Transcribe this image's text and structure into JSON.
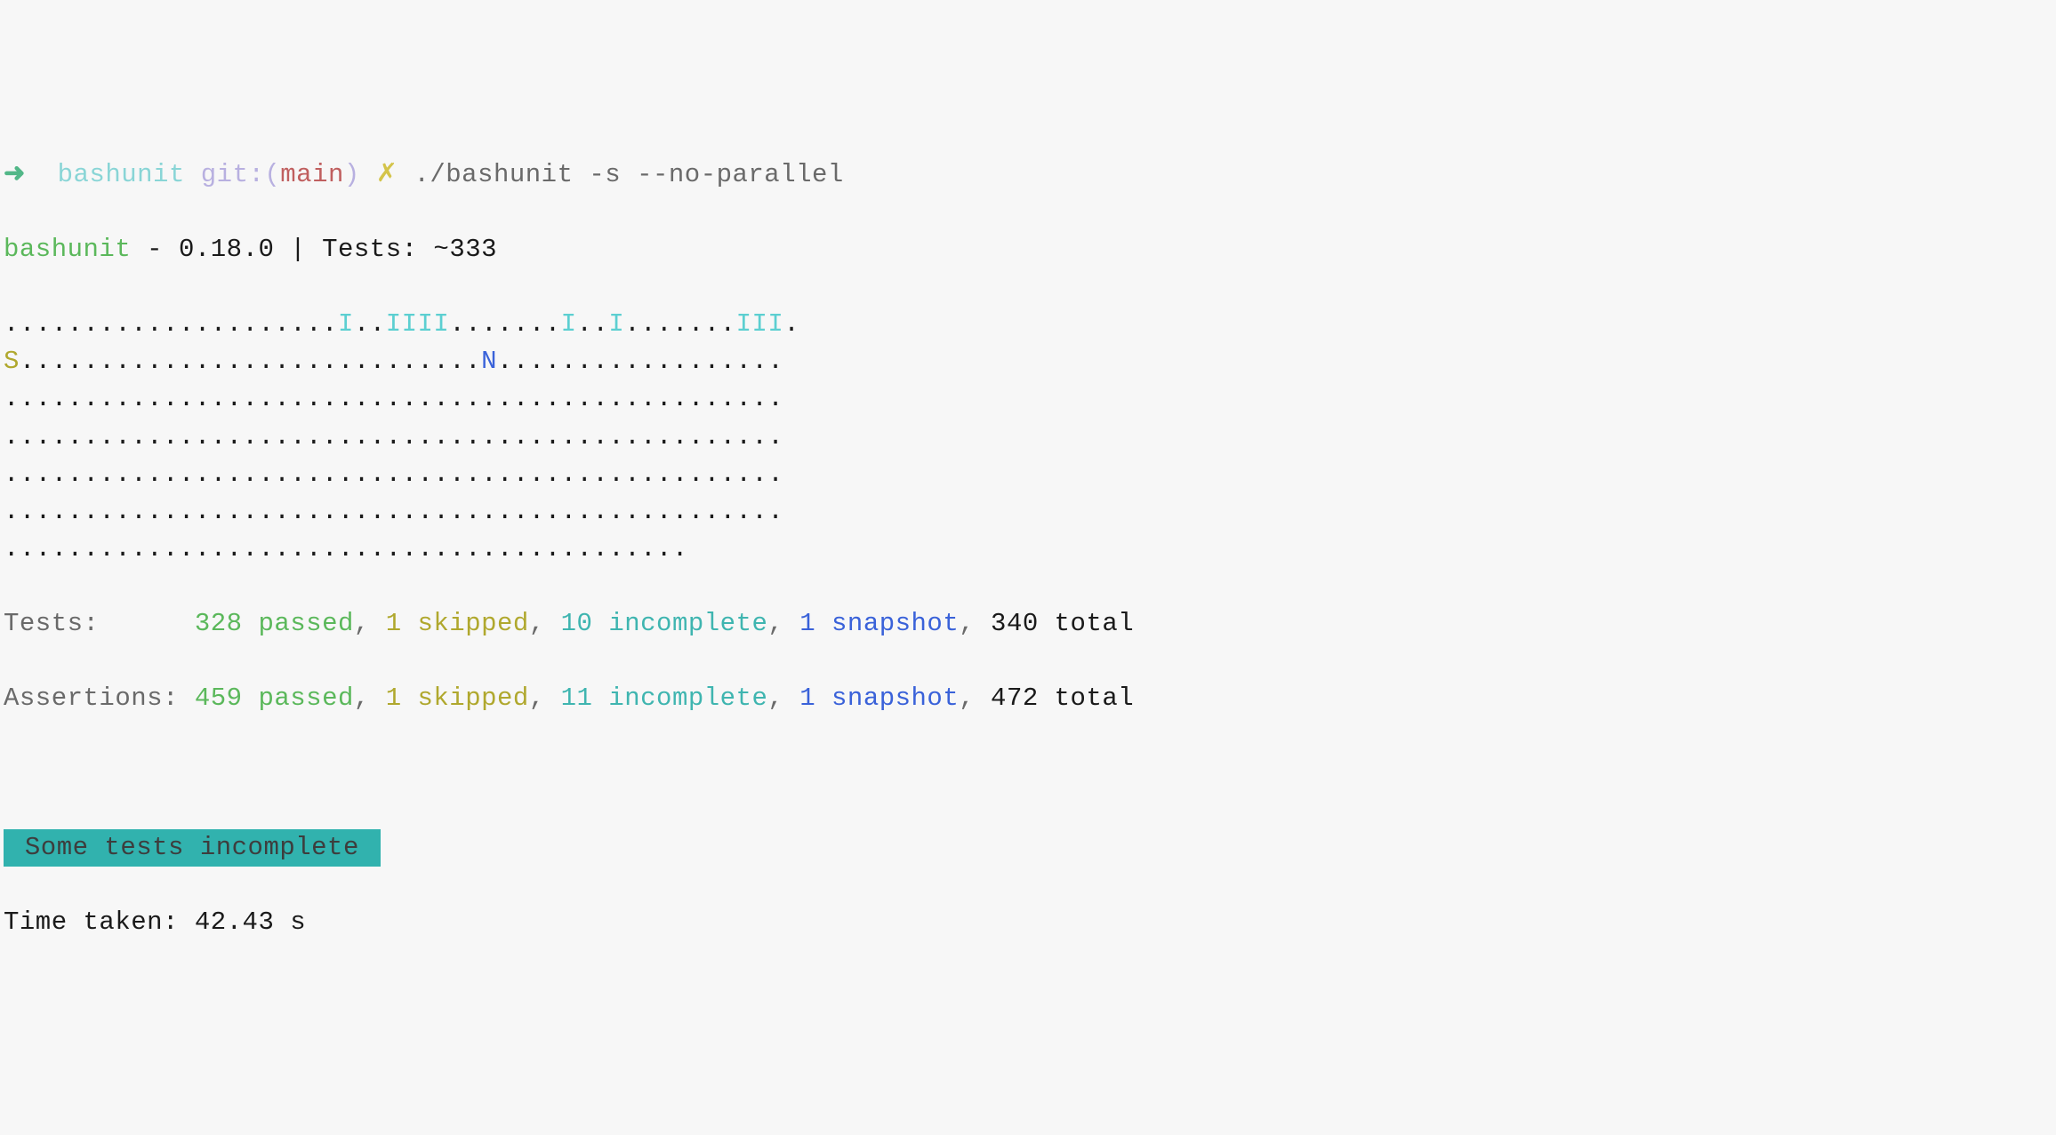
{
  "prompt": {
    "arrow": "➜",
    "dir": "bashunit",
    "git_prefix": "git:(",
    "branch": "main",
    "git_suffix": ")",
    "dirty": "✗",
    "command": "./bashunit -s --no-parallel"
  },
  "header": {
    "tool": "bashunit",
    "dash": " - ",
    "version": "0.18.0",
    "sep": " | ",
    "tests_label": "Tests: ",
    "tests_approx": "~333"
  },
  "progress": {
    "lines": [
      [
        {
          "cls": "dots",
          "t": "....................."
        },
        {
          "cls": "i-mark",
          "t": "I"
        },
        {
          "cls": "dots",
          "t": ".."
        },
        {
          "cls": "i-mark",
          "t": "IIII"
        },
        {
          "cls": "dots",
          "t": "......."
        },
        {
          "cls": "i-mark",
          "t": "I"
        },
        {
          "cls": "dots",
          "t": ".."
        },
        {
          "cls": "i-mark",
          "t": "I"
        },
        {
          "cls": "dots",
          "t": "......."
        },
        {
          "cls": "i-mark",
          "t": "III"
        },
        {
          "cls": "dots",
          "t": "."
        }
      ],
      [
        {
          "cls": "s-mark",
          "t": "S"
        },
        {
          "cls": "dots",
          "t": "............................."
        },
        {
          "cls": "n-mark",
          "t": "N"
        },
        {
          "cls": "dots",
          "t": ".................."
        }
      ],
      [
        {
          "cls": "dots",
          "t": "................................................."
        }
      ],
      [
        {
          "cls": "dots",
          "t": "................................................."
        }
      ],
      [
        {
          "cls": "dots",
          "t": "................................................."
        }
      ],
      [
        {
          "cls": "dots",
          "t": "................................................."
        }
      ],
      [
        {
          "cls": "dots",
          "t": "..........................................."
        }
      ]
    ]
  },
  "summary": {
    "tests_label": "Tests:      ",
    "assertions_label": "Assertions: ",
    "tests": {
      "passed": "328 passed",
      "skipped": "1 skipped",
      "incomplete": "10 incomplete",
      "snapshot": "1 snapshot",
      "total": "340 total"
    },
    "assertions": {
      "passed": "459 passed",
      "skipped": "1 skipped",
      "incomplete": "11 incomplete",
      "snapshot": "1 snapshot",
      "total": "472 total"
    }
  },
  "status": {
    "badge": " Some tests incomplete ",
    "time_label": "Time taken: ",
    "time_value": "42.43 s"
  }
}
